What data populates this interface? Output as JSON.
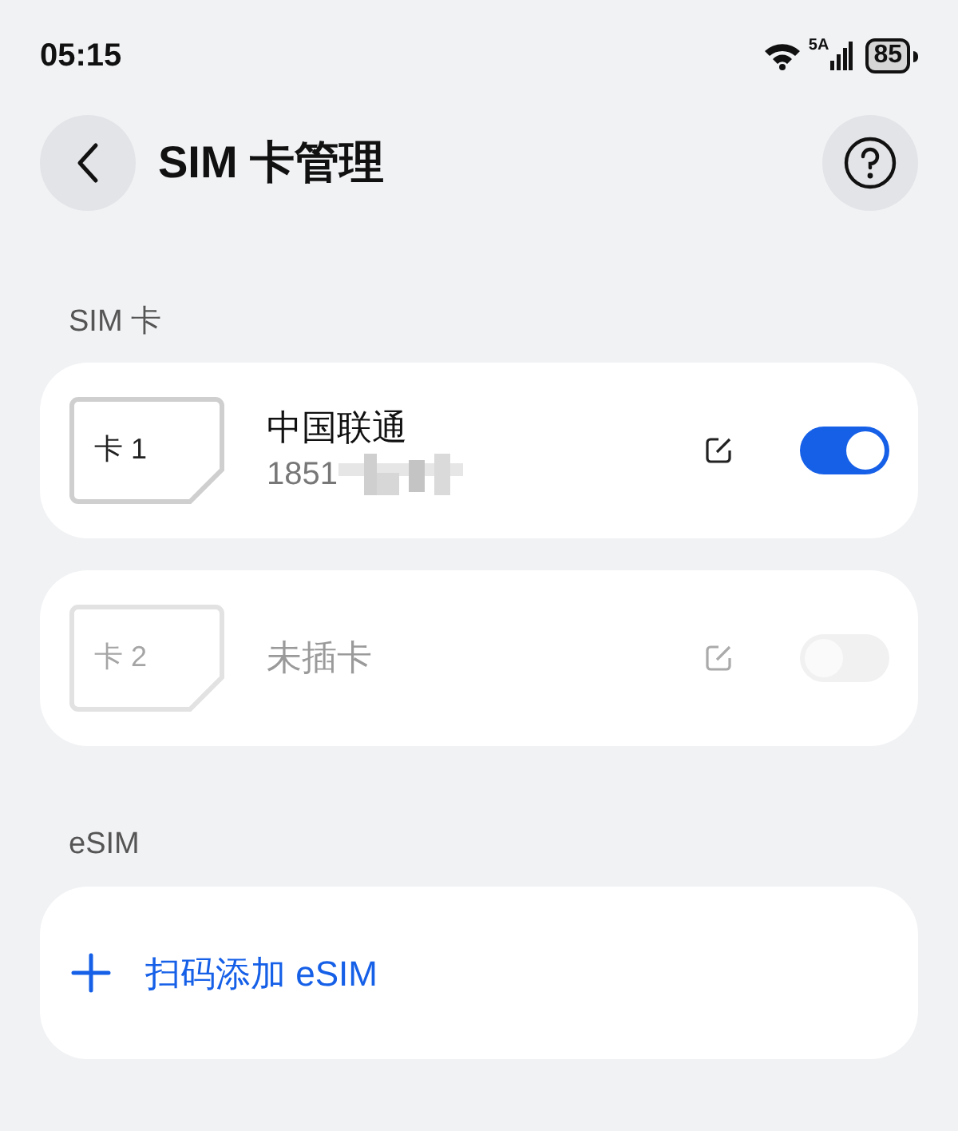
{
  "status_bar": {
    "time": "05:15",
    "network": "5A",
    "battery": "85"
  },
  "header": {
    "title": "SIM 卡管理"
  },
  "sim_section": {
    "label": "SIM 卡",
    "cards": [
      {
        "slot": "卡 1",
        "name": "中国联通",
        "number": "1851",
        "disabled": false,
        "on": true
      },
      {
        "slot": "卡 2",
        "name": "未插卡",
        "disabled": true,
        "on": false
      }
    ]
  },
  "esim_section": {
    "label": "eSIM",
    "action": "扫码添加 eSIM"
  }
}
